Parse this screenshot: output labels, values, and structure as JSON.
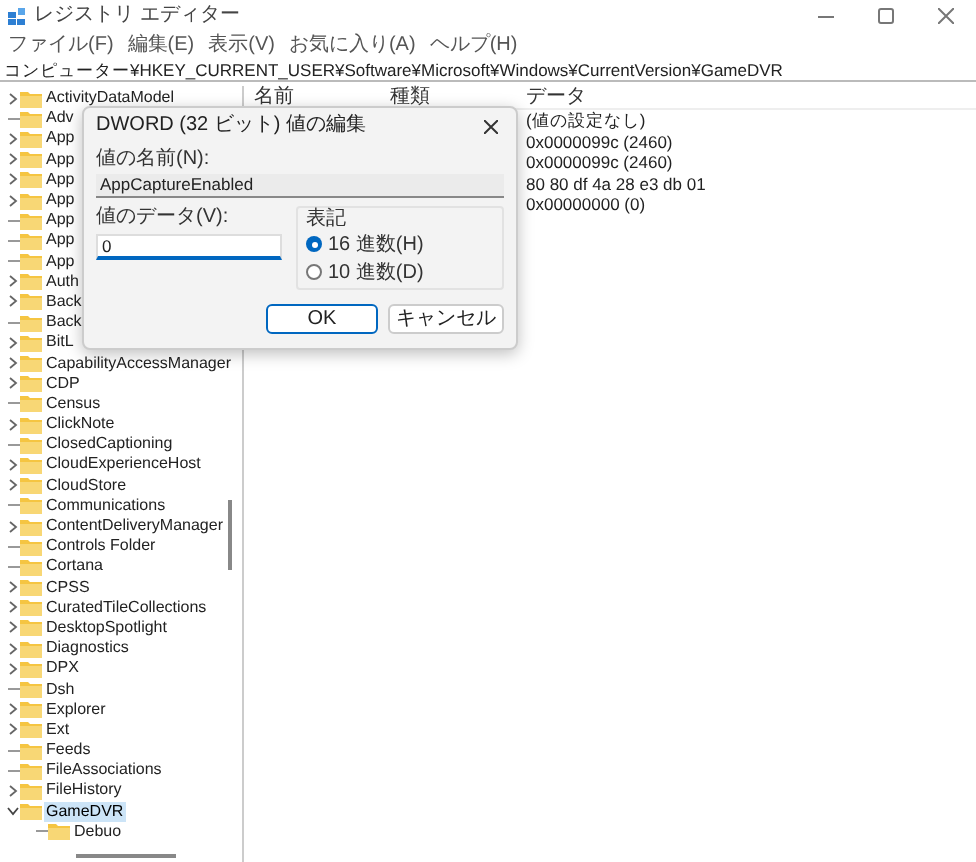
{
  "window": {
    "title": "レジストリ エディター"
  },
  "menu": [
    "ファイル(F)",
    "編集(E)",
    "表示(V)",
    "お気に入り(A)",
    "ヘルプ(H)"
  ],
  "address": "コンピューター¥HKEY_CURRENT_USER¥Software¥Microsoft¥Windows¥CurrentVersion¥GameDVR",
  "tree": [
    {
      "label": "ActivityDataModel",
      "expandable": true,
      "expanded": false,
      "selected": false
    },
    {
      "label": "Adv",
      "expandable": false,
      "selected": false
    },
    {
      "label": "App",
      "expandable": true,
      "expanded": false,
      "selected": false
    },
    {
      "label": "App",
      "expandable": true,
      "expanded": false,
      "selected": false
    },
    {
      "label": "App",
      "expandable": true,
      "expanded": false,
      "selected": false
    },
    {
      "label": "App",
      "expandable": true,
      "expanded": false,
      "selected": false
    },
    {
      "label": "App",
      "expandable": false,
      "selected": false
    },
    {
      "label": "App",
      "expandable": false,
      "selected": false
    },
    {
      "label": "App",
      "expandable": false,
      "selected": false
    },
    {
      "label": "Auth",
      "expandable": true,
      "expanded": false,
      "selected": false
    },
    {
      "label": "Back",
      "expandable": true,
      "expanded": false,
      "selected": false
    },
    {
      "label": "Back",
      "expandable": false,
      "selected": false
    },
    {
      "label": "BitL",
      "expandable": true,
      "expanded": false,
      "selected": false
    },
    {
      "label": "CapabilityAccessManager",
      "expandable": true,
      "expanded": false,
      "selected": false
    },
    {
      "label": "CDP",
      "expandable": true,
      "expanded": false,
      "selected": false
    },
    {
      "label": "Census",
      "expandable": false,
      "selected": false
    },
    {
      "label": "ClickNote",
      "expandable": true,
      "expanded": false,
      "selected": false
    },
    {
      "label": "ClosedCaptioning",
      "expandable": false,
      "selected": false
    },
    {
      "label": "CloudExperienceHost",
      "expandable": true,
      "expanded": false,
      "selected": false
    },
    {
      "label": "CloudStore",
      "expandable": true,
      "expanded": false,
      "selected": false
    },
    {
      "label": "Communications",
      "expandable": false,
      "selected": false
    },
    {
      "label": "ContentDeliveryManager",
      "expandable": true,
      "expanded": false,
      "selected": false
    },
    {
      "label": "Controls Folder",
      "expandable": false,
      "selected": false
    },
    {
      "label": "Cortana",
      "expandable": false,
      "selected": false
    },
    {
      "label": "CPSS",
      "expandable": true,
      "expanded": false,
      "selected": false
    },
    {
      "label": "CuratedTileCollections",
      "expandable": true,
      "expanded": false,
      "selected": false
    },
    {
      "label": "DesktopSpotlight",
      "expandable": true,
      "expanded": false,
      "selected": false
    },
    {
      "label": "Diagnostics",
      "expandable": true,
      "expanded": false,
      "selected": false
    },
    {
      "label": "DPX",
      "expandable": true,
      "expanded": false,
      "selected": false
    },
    {
      "label": "Dsh",
      "expandable": false,
      "selected": false
    },
    {
      "label": "Explorer",
      "expandable": true,
      "expanded": false,
      "selected": false
    },
    {
      "label": "Ext",
      "expandable": true,
      "expanded": false,
      "selected": false
    },
    {
      "label": "Feeds",
      "expandable": false,
      "selected": false
    },
    {
      "label": "FileAssociations",
      "expandable": false,
      "selected": false
    },
    {
      "label": "FileHistory",
      "expandable": true,
      "expanded": false,
      "selected": false
    },
    {
      "label": "GameDVR",
      "expandable": true,
      "expanded": true,
      "selected": true,
      "children": [
        {
          "label": "Debuo",
          "expandable": false,
          "selected": false
        }
      ]
    }
  ],
  "list": {
    "columns": [
      "名前",
      "種類",
      "データ"
    ],
    "rows": [
      {
        "data": "(値の設定なし)"
      },
      {
        "data": "0x0000099c (2460)"
      },
      {
        "data": "0x0000099c (2460)"
      },
      {
        "data": "80 80 df 4a 28 e3 db 01"
      },
      {
        "data": "0x00000000 (0)"
      }
    ]
  },
  "dialog": {
    "title": "DWORD (32 ビット) 値の編集",
    "name_label": "値の名前(N):",
    "name_value": "AppCaptureEnabled",
    "data_label": "値のデータ(V):",
    "data_value": "0",
    "base_label": "表記",
    "radios": [
      {
        "label": "16 進数(H)",
        "selected": true
      },
      {
        "label": "10 進数(D)",
        "selected": false
      }
    ],
    "buttons": [
      {
        "label": "OK",
        "default": true
      },
      {
        "label": "キャンセル",
        "default": false
      }
    ]
  }
}
